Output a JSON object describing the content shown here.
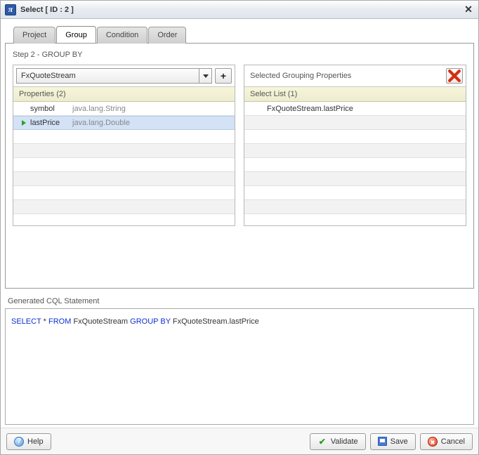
{
  "titlebar": {
    "icon_glyph": "π",
    "title": "Select [ ID : 2 ]"
  },
  "tabs": {
    "project": "Project",
    "group": "Group",
    "condition": "Condition",
    "order": "Order",
    "active": "group"
  },
  "step_label": "Step 2 - GROUP BY",
  "left": {
    "source_selected": "FxQuoteStream",
    "add_label": "+",
    "properties_header": "Properties (2)",
    "rows": [
      {
        "name": "symbol",
        "type": "java.lang.String",
        "selected": false
      },
      {
        "name": "lastPrice",
        "type": "java.lang.Double",
        "selected": true
      }
    ]
  },
  "right": {
    "title": "Selected Grouping Properties",
    "list_header": "Select List (1)",
    "items": [
      "FxQuoteStream.lastPrice"
    ]
  },
  "generated_label": "Generated CQL Statement",
  "cql": {
    "select": "SELECT",
    "star": "*",
    "from": "FROM",
    "stream": "FxQuoteStream",
    "groupby": "GROUP BY",
    "expr": "FxQuoteStream.lastPrice"
  },
  "footer": {
    "help": "Help",
    "validate": "Validate",
    "save": "Save",
    "cancel": "Cancel"
  }
}
